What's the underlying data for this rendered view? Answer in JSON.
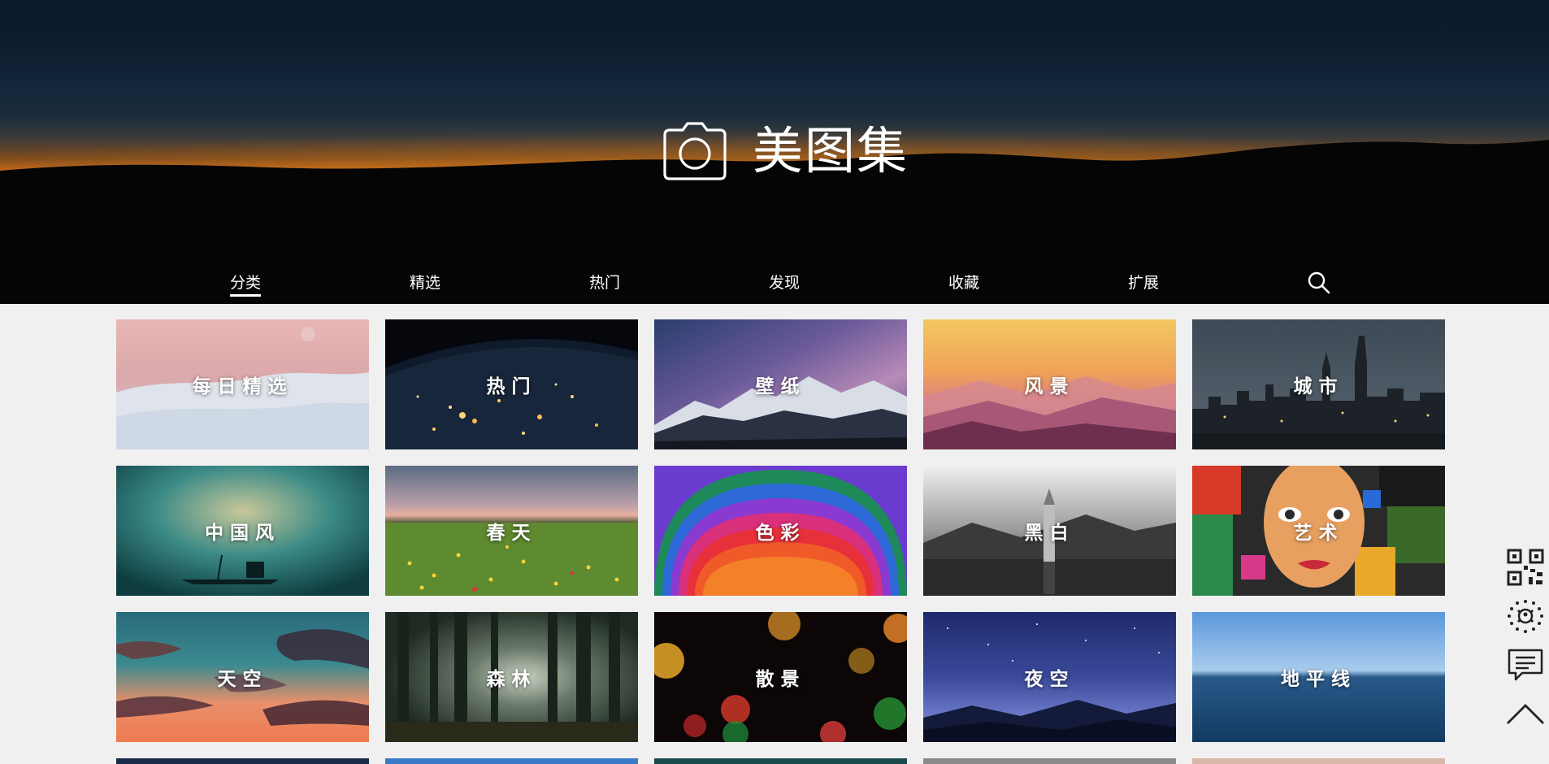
{
  "brand": {
    "title": "美图集",
    "icon": "camera-icon"
  },
  "nav": {
    "items": [
      {
        "label": "分类",
        "active": true
      },
      {
        "label": "精选",
        "active": false
      },
      {
        "label": "热门",
        "active": false
      },
      {
        "label": "发现",
        "active": false
      },
      {
        "label": "收藏",
        "active": false
      },
      {
        "label": "扩展",
        "active": false
      }
    ],
    "search_icon": "search-icon"
  },
  "categories": [
    {
      "label": "每日精选",
      "theme": "pink-dunes"
    },
    {
      "label": "热门",
      "theme": "earth-night"
    },
    {
      "label": "壁纸",
      "theme": "milky-way-mountains"
    },
    {
      "label": "风景",
      "theme": "sunset-mountains"
    },
    {
      "label": "城市",
      "theme": "city-skyline"
    },
    {
      "label": "中国风",
      "theme": "teal-boat"
    },
    {
      "label": "春天",
      "theme": "flower-meadow"
    },
    {
      "label": "色彩",
      "theme": "rainbow-arcs"
    },
    {
      "label": "黑白",
      "theme": "bw-tower"
    },
    {
      "label": "艺术",
      "theme": "graffiti-face"
    },
    {
      "label": "天空",
      "theme": "sunset-clouds"
    },
    {
      "label": "森林",
      "theme": "forest"
    },
    {
      "label": "散景",
      "theme": "bokeh"
    },
    {
      "label": "夜空",
      "theme": "night-sky"
    },
    {
      "label": "地平线",
      "theme": "ocean-horizon"
    }
  ],
  "sidebar": {
    "buttons": [
      {
        "icon": "qr-code-icon"
      },
      {
        "icon": "mini-program-code-icon"
      },
      {
        "icon": "comment-icon"
      },
      {
        "icon": "back-to-top-icon"
      }
    ]
  }
}
